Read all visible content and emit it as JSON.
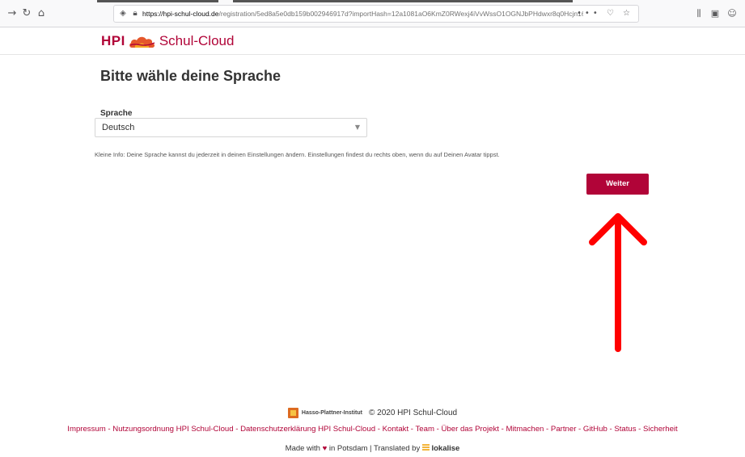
{
  "browser": {
    "url_domain": "https://hpi-schul-cloud.de",
    "url_path": "/registration/5ed8a5e0db159b002946917d?importHash=12a1081aO6KmZ0RWexj4iVvWssO1OGNJbPHdwxr8q0Hcjn16",
    "url_actions": "••• ♡ ☆"
  },
  "header": {
    "logo_hpi": "HPI",
    "logo_name": "Schul-Cloud"
  },
  "main": {
    "title": "Bitte wähle deine Sprache",
    "language_label": "Sprache",
    "language_value": "Deutsch",
    "info": "Kleine Info: Deine Sprache kannst du jederzeit in deinen Einstellungen ändern. Einstellungen findest du rechts oben, wenn du auf Deinen Avatar tippst.",
    "continue_label": "Weiter"
  },
  "annotation": {
    "arrow_color": "#ff0000"
  },
  "footer": {
    "institute": "Hasso-Plattner-Institut",
    "copyright": "© 2020 HPI Schul-Cloud",
    "links": [
      "Impressum",
      "Nutzungsordnung HPI Schul-Cloud",
      "Datenschutzerklärung HPI Schul-Cloud",
      "Kontakt",
      "Team",
      "Über das Projekt",
      "Mitmachen",
      "Partner",
      "GitHub",
      "Status",
      "Sicherheit"
    ],
    "made_with": "Made with",
    "in_potsdam": "in Potsdam | Translated by",
    "lokalise": "lokalise"
  },
  "colors": {
    "brand": "#b10438"
  }
}
